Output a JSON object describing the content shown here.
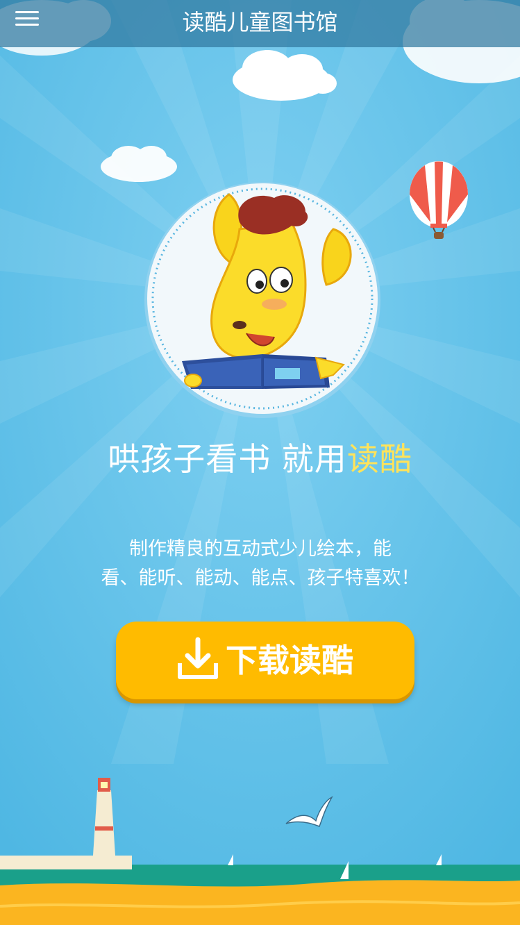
{
  "header": {
    "menu_icon": "hamburger-menu-icon",
    "title": "读酷儿童图书馆"
  },
  "hero": {
    "mascot": "yellow-dog-reading-book-illustration",
    "slogan_prefix": "哄孩子看书 就用",
    "slogan_brand": "读酷",
    "brand_color": "#ffe35a"
  },
  "description": {
    "line1": "制作精良的互动式少儿绘本，能",
    "line2": "看、能听、能动、能点、孩子特喜欢！"
  },
  "download_button": {
    "icon": "download-icon",
    "label": "下载读酷",
    "color": "#ffbb00"
  },
  "colors": {
    "sky": "#57bce6",
    "sea": "#1aa08a",
    "sand": "#fbb520",
    "header": "#3a84aa"
  }
}
